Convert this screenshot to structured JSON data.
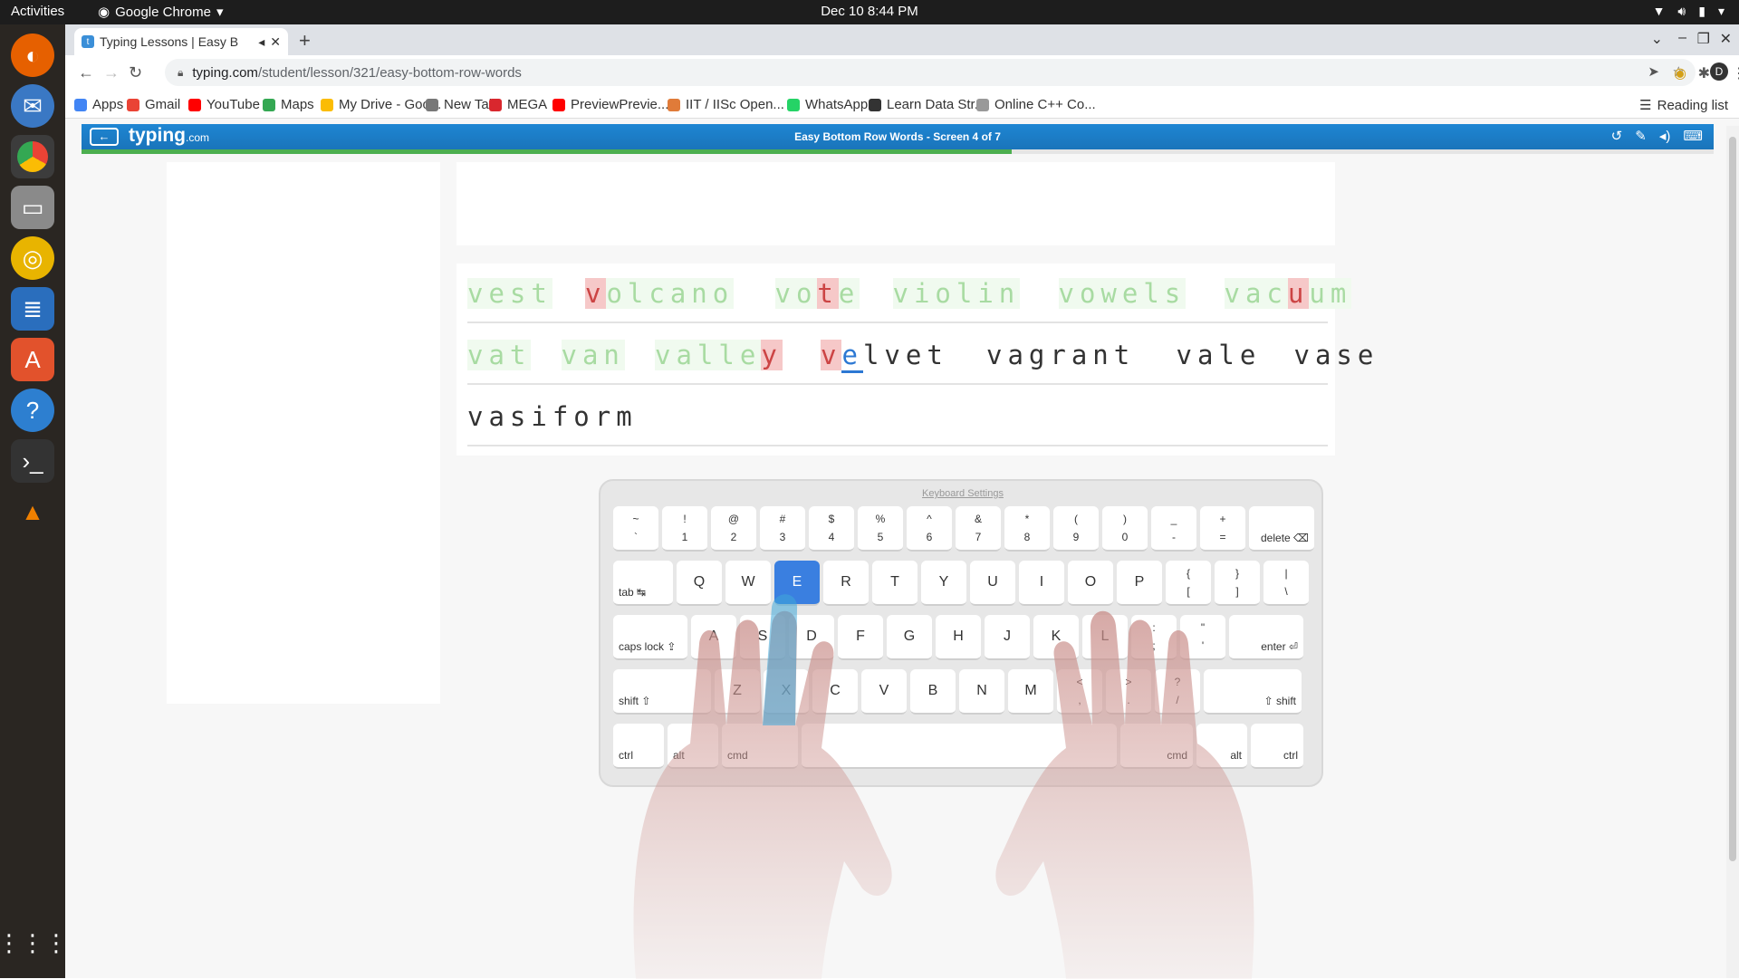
{
  "system": {
    "activities": "Activities",
    "app_name": "Google Chrome",
    "clock": "Dec 10  8:44 PM"
  },
  "browser": {
    "tab_title": "Typing Lessons | Easy B",
    "url_host": "typing.com",
    "url_path": "/student/lesson/321/easy-bottom-row-words",
    "reading_list": "Reading list",
    "profile_initial": "D"
  },
  "bookmarks": [
    {
      "label": "Apps",
      "color": "#4285f4"
    },
    {
      "label": "Gmail",
      "color": "#ea4335"
    },
    {
      "label": "YouTube",
      "color": "#ff0000"
    },
    {
      "label": "Maps",
      "color": "#34a853"
    },
    {
      "label": "My Drive - Goo...",
      "color": "#fbbc04"
    },
    {
      "label": "New Tab",
      "color": "#777777"
    },
    {
      "label": "MEGA",
      "color": "#d9272e"
    },
    {
      "label": "PreviewPrevie...",
      "color": "#ff0000"
    },
    {
      "label": "IIT / IISc Open...",
      "color": "#e07b39"
    },
    {
      "label": "WhatsApp",
      "color": "#25d366"
    },
    {
      "label": "Learn Data Str...",
      "color": "#333333"
    },
    {
      "label": "Online C++ Co...",
      "color": "#999999"
    }
  ],
  "header": {
    "logo": "typing",
    "logo_suffix": ".com",
    "title": "Easy Bottom Row Words - Screen 4 of 7",
    "progress_percent": 57
  },
  "lesson": {
    "lines": [
      [
        {
          "segs": [
            {
              "t": "vest",
              "s": "ok"
            }
          ]
        },
        {
          "segs": [
            {
              "t": "v",
              "s": "bad"
            },
            {
              "t": "olcano",
              "s": "ok"
            }
          ]
        },
        {
          "segs": [
            {
              "t": "vo",
              "s": "ok"
            },
            {
              "t": "t",
              "s": "bad"
            },
            {
              "t": "e",
              "s": "ok"
            }
          ]
        },
        {
          "segs": [
            {
              "t": "violin",
              "s": "ok"
            }
          ]
        },
        {
          "segs": [
            {
              "t": "vowels",
              "s": "ok"
            }
          ]
        },
        {
          "segs": [
            {
              "t": "vac",
              "s": "ok"
            },
            {
              "t": "u",
              "s": "bad"
            },
            {
              "t": "um",
              "s": "ok"
            }
          ]
        }
      ],
      [
        {
          "segs": [
            {
              "t": "vat",
              "s": "ok"
            }
          ]
        },
        {
          "segs": [
            {
              "t": "van",
              "s": "ok"
            }
          ]
        },
        {
          "segs": [
            {
              "t": "valle",
              "s": "ok"
            },
            {
              "t": "y",
              "s": "bad"
            }
          ]
        },
        {
          "segs": [
            {
              "t": "v",
              "s": "bad"
            },
            {
              "t": "e",
              "s": "cur"
            },
            {
              "t": "lvet",
              "s": "pend"
            }
          ]
        },
        {
          "segs": [
            {
              "t": "vagrant",
              "s": "pend"
            }
          ]
        },
        {
          "segs": [
            {
              "t": "vale",
              "s": "pend"
            }
          ]
        },
        {
          "segs": [
            {
              "t": "vase",
              "s": "pend"
            }
          ]
        }
      ],
      [
        {
          "segs": [
            {
              "t": "vasiform",
              "s": "pend"
            }
          ]
        }
      ]
    ]
  },
  "keyboard": {
    "settings_link": "Keyboard Settings",
    "highlight_key": "E",
    "row1": [
      [
        "~",
        "`"
      ],
      [
        "!",
        "1"
      ],
      [
        "@",
        "2"
      ],
      [
        "#",
        "3"
      ],
      [
        "$",
        "4"
      ],
      [
        "%",
        "5"
      ],
      [
        "^",
        "6"
      ],
      [
        "&",
        "7"
      ],
      [
        "*",
        "8"
      ],
      [
        "(",
        "9"
      ],
      [
        ")",
        "0"
      ],
      [
        "_",
        "-"
      ],
      [
        "+",
        "="
      ]
    ],
    "row1_end": "delete ⌫",
    "row2_start": "tab ↹",
    "row2": [
      "Q",
      "W",
      "E",
      "R",
      "T",
      "Y",
      "U",
      "I",
      "O",
      "P"
    ],
    "row2_sym": [
      [
        "{",
        "["
      ],
      [
        "}",
        "]"
      ],
      [
        "|",
        "\\"
      ]
    ],
    "row3_start": "caps lock ⇪",
    "row3": [
      "A",
      "S",
      "D",
      "F",
      "G",
      "H",
      "J",
      "K",
      "L"
    ],
    "row3_sym": [
      [
        ":",
        ";"
      ],
      [
        "\"",
        "'"
      ]
    ],
    "row3_end": "enter ⏎",
    "row4_start": "shift ⇧",
    "row4": [
      "Z",
      "X",
      "C",
      "V",
      "B",
      "N",
      "M"
    ],
    "row4_sym": [
      [
        "<",
        ","
      ],
      [
        ">",
        "."
      ],
      [
        "?",
        "/"
      ]
    ],
    "row4_end": "⇧ shift",
    "row5": [
      "ctrl",
      "alt",
      "cmd",
      "",
      "cmd",
      "alt",
      "ctrl"
    ]
  }
}
